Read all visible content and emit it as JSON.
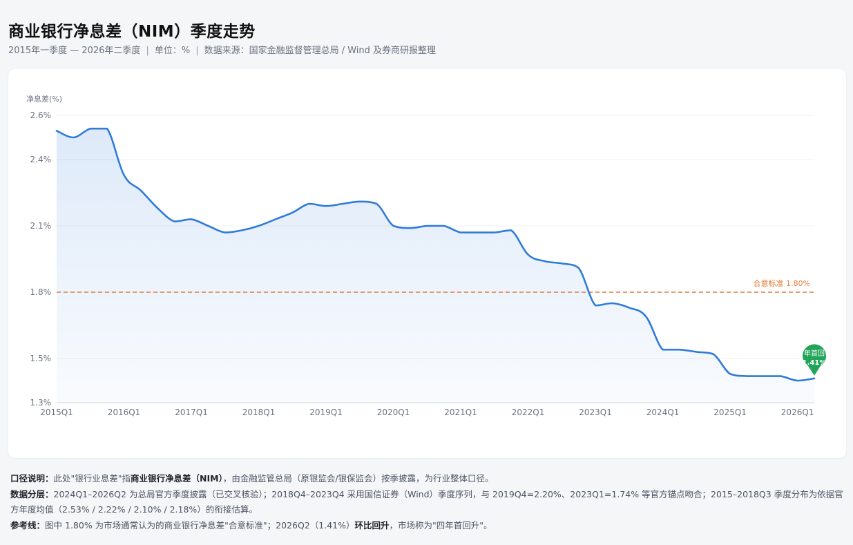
{
  "header": {
    "title": "商业银行净息差（NIM）季度走势",
    "period": "2015年一季度 — 2026年二季度",
    "unit": "单位：%",
    "source": "数据来源：国家金融监督管理总局 / Wind 及券商研报整理"
  },
  "chart_data": {
    "type": "line",
    "title": "",
    "ylabel": "净息差(%)",
    "xlabel": "",
    "ylim": [
      1.3,
      2.6
    ],
    "yticks": [
      "2.6%",
      "2.4%",
      "2.1%",
      "1.8%",
      "1.5%",
      "1.3%"
    ],
    "ytick_values": [
      2.6,
      2.4,
      2.1,
      1.8,
      1.5,
      1.3
    ],
    "xtick_labels": [
      "2015Q1",
      "2016Q1",
      "2017Q1",
      "2018Q1",
      "2019Q1",
      "2020Q1",
      "2021Q1",
      "2022Q1",
      "2023Q1",
      "2024Q1",
      "2025Q1",
      "2026Q1"
    ],
    "grid": true,
    "series": [
      {
        "name": "",
        "color": "#2f7bd9",
        "x": [
          "2015Q1",
          "2015Q2",
          "2015Q3",
          "2015Q4",
          "2016Q1",
          "2016Q2",
          "2016Q3",
          "2016Q4",
          "2017Q1",
          "2017Q2",
          "2017Q3",
          "2017Q4",
          "2018Q1",
          "2018Q2",
          "2018Q3",
          "2018Q4",
          "2019Q1",
          "2019Q2",
          "2019Q3",
          "2019Q4",
          "2020Q1",
          "2020Q2",
          "2020Q3",
          "2020Q4",
          "2021Q1",
          "2021Q2",
          "2021Q3",
          "2021Q4",
          "2022Q1",
          "2022Q2",
          "2022Q3",
          "2022Q4",
          "2023Q1",
          "2023Q2",
          "2023Q3",
          "2023Q4",
          "2024Q1",
          "2024Q2",
          "2024Q3",
          "2024Q4",
          "2025Q1",
          "2025Q2",
          "2025Q3",
          "2025Q4",
          "2026Q1",
          "2026Q2"
        ],
        "values": [
          2.53,
          2.5,
          2.54,
          2.54,
          2.33,
          2.26,
          2.18,
          2.12,
          2.13,
          2.1,
          2.07,
          2.08,
          2.1,
          2.13,
          2.16,
          2.2,
          2.19,
          2.2,
          2.21,
          2.2,
          2.1,
          2.09,
          2.1,
          2.1,
          2.07,
          2.07,
          2.07,
          2.08,
          1.97,
          1.94,
          1.93,
          1.91,
          1.74,
          1.75,
          1.73,
          1.69,
          1.54,
          1.54,
          1.53,
          1.52,
          1.43,
          1.42,
          1.42,
          1.42,
          1.4,
          1.41
        ]
      }
    ],
    "reference_line": {
      "value": 1.8,
      "label": "合意标准 1.80%",
      "color": "#e07b3a"
    },
    "annotation": {
      "text_top": "年首回",
      "text_bottom": "1.41%",
      "color": "#22a559"
    }
  },
  "notes": [
    {
      "label": "口径说明：",
      "segments": [
        {
          "t": "此处\"银行业息差\"指",
          "b": false
        },
        {
          "t": "商业银行净息差（NIM）",
          "b": true
        },
        {
          "t": "，由金融监管总局（原银监会/银保监会）按季披露，为行业整体口径。",
          "b": false
        }
      ]
    },
    {
      "label": "数据分层：",
      "segments": [
        {
          "t": "2024Q1–2026Q2 为总局官方季度披露（已交叉核验）；2018Q4–2023Q4 采用国信证券（Wind）季度序列，与 2019Q4=2.20%、2023Q1=1.74% 等官方锚点吻合；2015–2018Q3 季度分布为依据官方年度均值（2.53% / 2.22% / 2.10% / 2.18%）的衔接估算。",
          "b": false
        }
      ]
    },
    {
      "label": "参考线：",
      "segments": [
        {
          "t": "图中 1.80% 为市场通常认为的商业银行净息差\"合意标准\"；2026Q2（1.41%）",
          "b": false
        },
        {
          "t": "环比回升",
          "b": true
        },
        {
          "t": "，市场称为\"四年首回升\"。",
          "b": false
        }
      ]
    }
  ]
}
